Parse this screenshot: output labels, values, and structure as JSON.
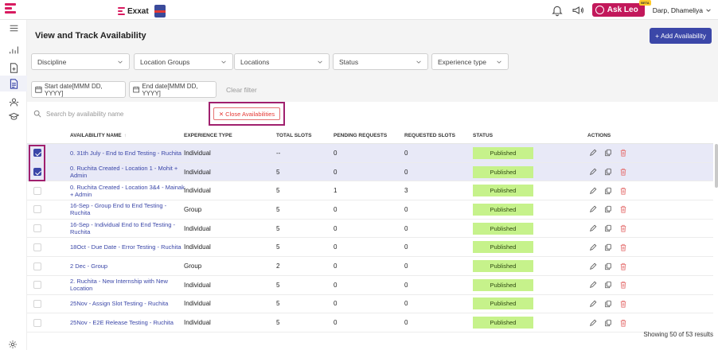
{
  "header": {
    "brand_word": "Exxat",
    "ask_label": "Ask Leo",
    "beta_label": "BETA",
    "user_name": "Darp, Dhameliya"
  },
  "page": {
    "title": "View and Track Availability",
    "add_button": "+ Add Availability"
  },
  "filters": {
    "discipline": "Discipline",
    "location_groups": "Location Groups",
    "locations": "Locations",
    "status": "Status",
    "experience_type": "Experience type",
    "start_date_placeholder": "Start date[MMM DD, YYYY]",
    "end_date_placeholder": "End date[MMM DD, YYYY]",
    "clear": "Clear filter"
  },
  "table": {
    "search_placeholder": "Search by availability name",
    "close_button": "✕ Close Availabilities",
    "columns": {
      "name": "AVAILABILITY NAME",
      "experience": "EXPERIENCE TYPE",
      "total": "TOTAL SLOTS",
      "pending": "PENDING REQUESTS",
      "requested": "REQUESTED SLOTS",
      "status": "STATUS",
      "actions": "ACTIONS"
    },
    "rows": [
      {
        "name": "0. 31th July - End to End Testing - Ruchita",
        "exp": "Individual",
        "total": "--",
        "pending": "0",
        "requested": "0",
        "status": "Published",
        "checked": true
      },
      {
        "name": "0. Ruchita Created - Location 1 - Mohit + Admin",
        "exp": "Individual",
        "total": "5",
        "pending": "0",
        "requested": "0",
        "status": "Published",
        "checked": true
      },
      {
        "name": "0. Ruchita Created - Location 3&4 - Mainak + Admin",
        "exp": "Individual",
        "total": "5",
        "pending": "1",
        "requested": "3",
        "status": "Published",
        "checked": false
      },
      {
        "name": "16-Sep - Group End to End Testing - Ruchita",
        "exp": "Group",
        "total": "5",
        "pending": "0",
        "requested": "0",
        "status": "Published",
        "checked": false
      },
      {
        "name": "16-Sep - Individual End to End Testing - Ruchita",
        "exp": "Individual",
        "total": "5",
        "pending": "0",
        "requested": "0",
        "status": "Published",
        "checked": false
      },
      {
        "name": "18Oct - Due Date - Error Testing - Ruchita",
        "exp": "Individual",
        "total": "5",
        "pending": "0",
        "requested": "0",
        "status": "Published",
        "checked": false
      },
      {
        "name": "2 Dec - Group",
        "exp": "Group",
        "total": "2",
        "pending": "0",
        "requested": "0",
        "status": "Published",
        "checked": false
      },
      {
        "name": "2. Ruchita - New Internship with New Location",
        "exp": "Individual",
        "total": "5",
        "pending": "0",
        "requested": "0",
        "status": "Published",
        "checked": false
      },
      {
        "name": "25Nov - Assign Slot Testing - Ruchita",
        "exp": "Individual",
        "total": "5",
        "pending": "0",
        "requested": "0",
        "status": "Published",
        "checked": false
      },
      {
        "name": "25Nov - E2E Release Testing - Ruchita",
        "exp": "Individual",
        "total": "5",
        "pending": "0",
        "requested": "0",
        "status": "Published",
        "checked": false
      }
    ],
    "footer": "Showing 50 of 53 results"
  },
  "colors": {
    "primary": "#3b47a8",
    "brand": "#d81b60",
    "ask_leo": "#c2185b",
    "highlight": "#a0206e",
    "published": "#c6f28b",
    "delete": "#e57373"
  }
}
